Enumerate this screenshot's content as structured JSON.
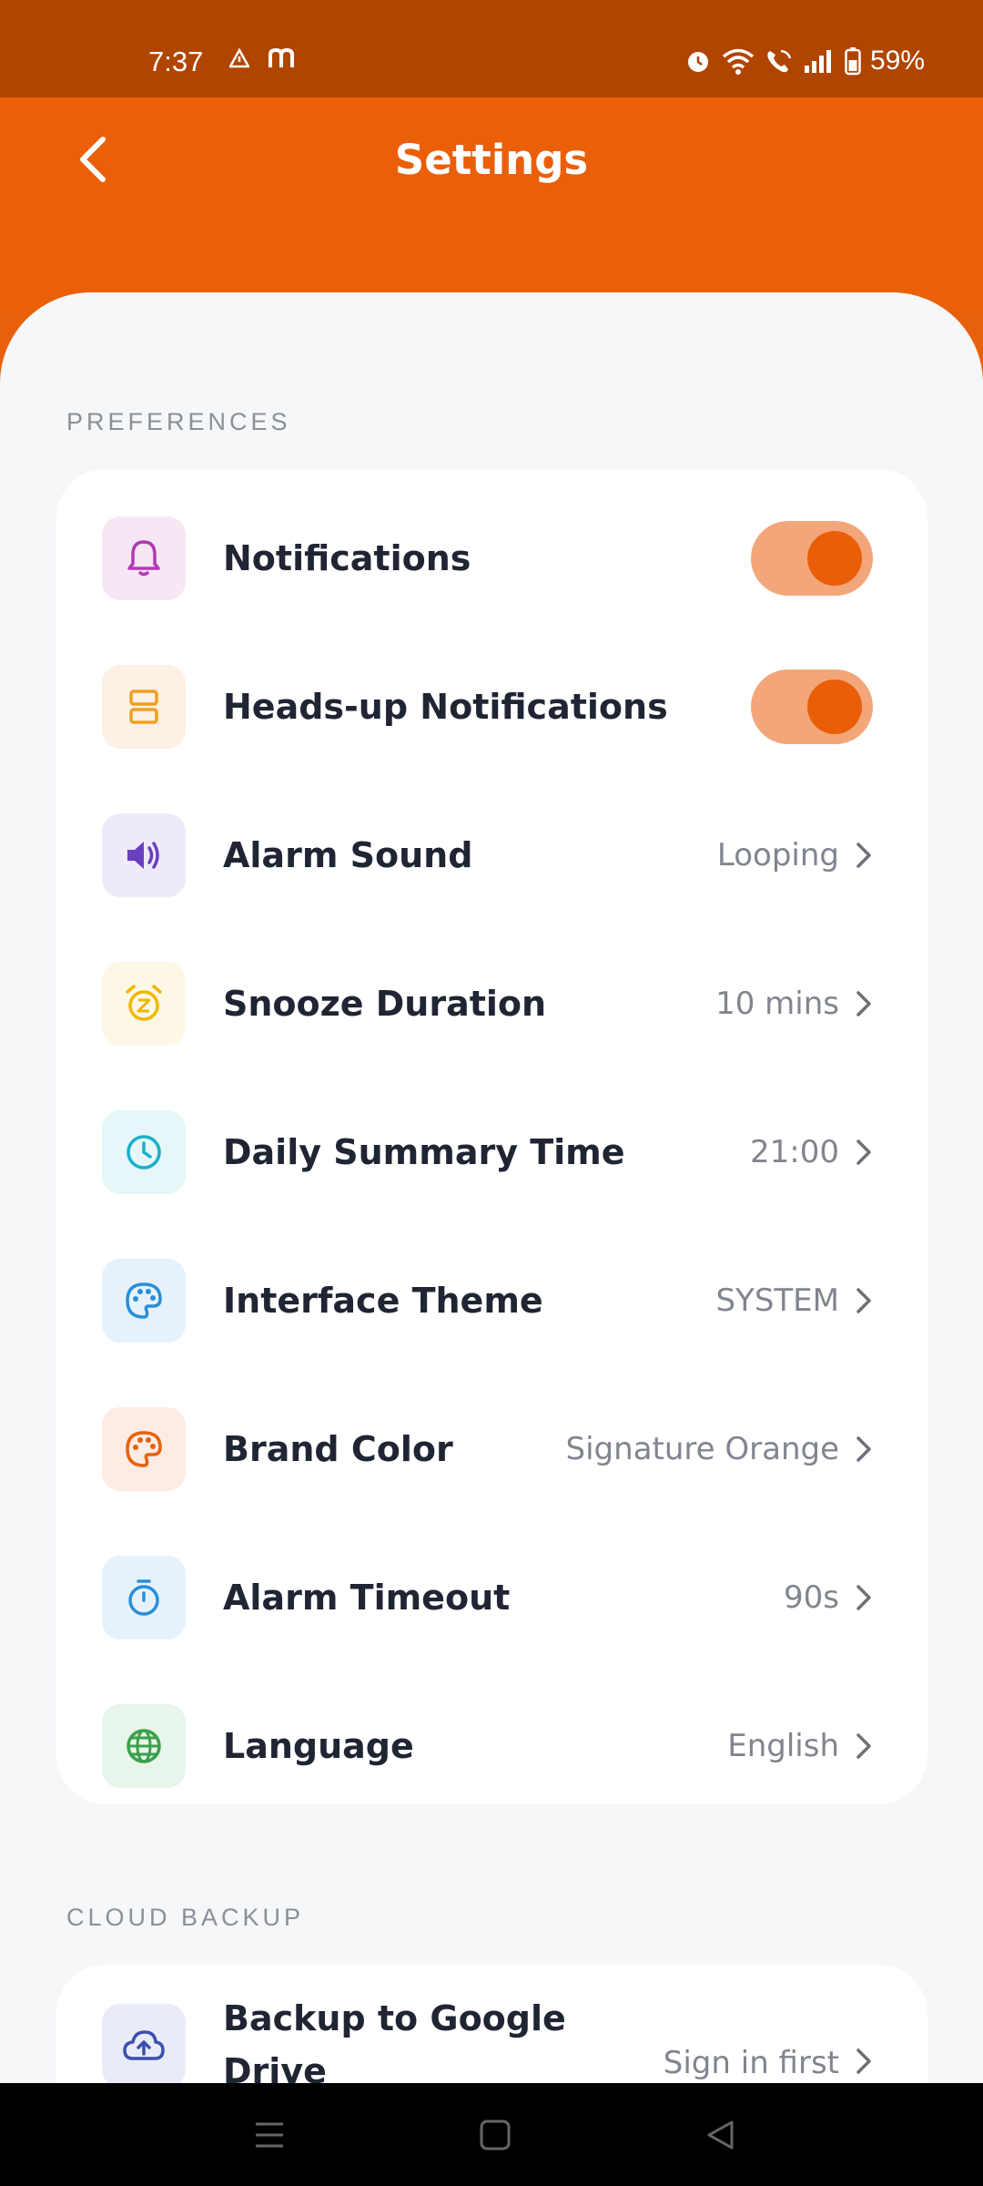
{
  "status_bar": {
    "time": "7:37",
    "battery": "59%"
  },
  "header": {
    "title": "Settings"
  },
  "sections": {
    "preferences": "PREFERENCES",
    "cloud_backup": "CLOUD BACKUP"
  },
  "preferences": {
    "notifications": {
      "label": "Notifications",
      "enabled": true
    },
    "heads_up": {
      "label": "Heads-up Notifications",
      "enabled": true
    },
    "alarm_sound": {
      "label": "Alarm Sound",
      "value": "Looping"
    },
    "snooze": {
      "label": "Snooze Duration",
      "value": "10 mins"
    },
    "daily_summary": {
      "label": "Daily Summary Time",
      "value": "21:00"
    },
    "theme": {
      "label": "Interface Theme",
      "value": "SYSTEM"
    },
    "brand_color": {
      "label": "Brand Color",
      "value": "Signature Orange"
    },
    "alarm_timeout": {
      "label": "Alarm Timeout",
      "value": "90s"
    },
    "language": {
      "label": "Language",
      "value": "English"
    }
  },
  "cloud": {
    "backup": {
      "label_line1": "Backup to Google",
      "label_line2": "Drive",
      "value": "Sign in first"
    }
  },
  "colors": {
    "accent": "#ea5f08",
    "status_bar": "#b04500",
    "toggle_track": "#f3a67a"
  }
}
